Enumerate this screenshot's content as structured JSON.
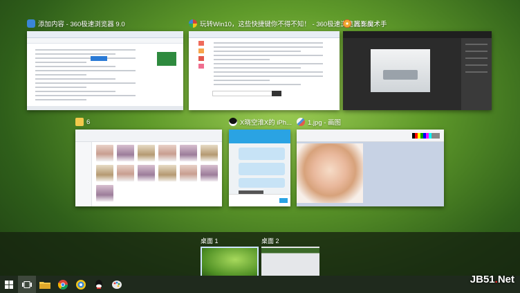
{
  "windows": [
    {
      "title": "添加内容 - 360极速浏览器 9.0",
      "icon": "360-browser-icon",
      "icon_color": "#3a86d8"
    },
    {
      "title": "玩转Win10，这些快捷键你不得不知！ - 360极速浏览器 9.0",
      "icon": "360-browser-icon",
      "icon_color": "#d0433a"
    },
    {
      "title": "光影魔术手",
      "icon": "photo-editor-icon",
      "icon_color": "#f0a830"
    },
    {
      "title": "6",
      "icon": "folder-icon",
      "icon_color": "#f2c94c"
    },
    {
      "title": "X晓空淮X的 iPh...",
      "icon": "qq-icon",
      "icon_color": "#111111"
    },
    {
      "title": "1.jpg - 画图",
      "icon": "paint-icon",
      "icon_color": "#4a90d9"
    }
  ],
  "desktops": [
    {
      "label": "桌面 1",
      "active": true
    },
    {
      "label": "桌面 2",
      "active": false
    }
  ],
  "taskbar": {
    "items": [
      "windows-start-icon",
      "task-view-icon",
      "file-explorer-icon",
      "chrome-icon",
      "360-browser-icon",
      "qq-icon",
      "paint-icon"
    ]
  },
  "watermark": {
    "brand": "JB51",
    "dot": ".",
    "suffix": "Net"
  }
}
